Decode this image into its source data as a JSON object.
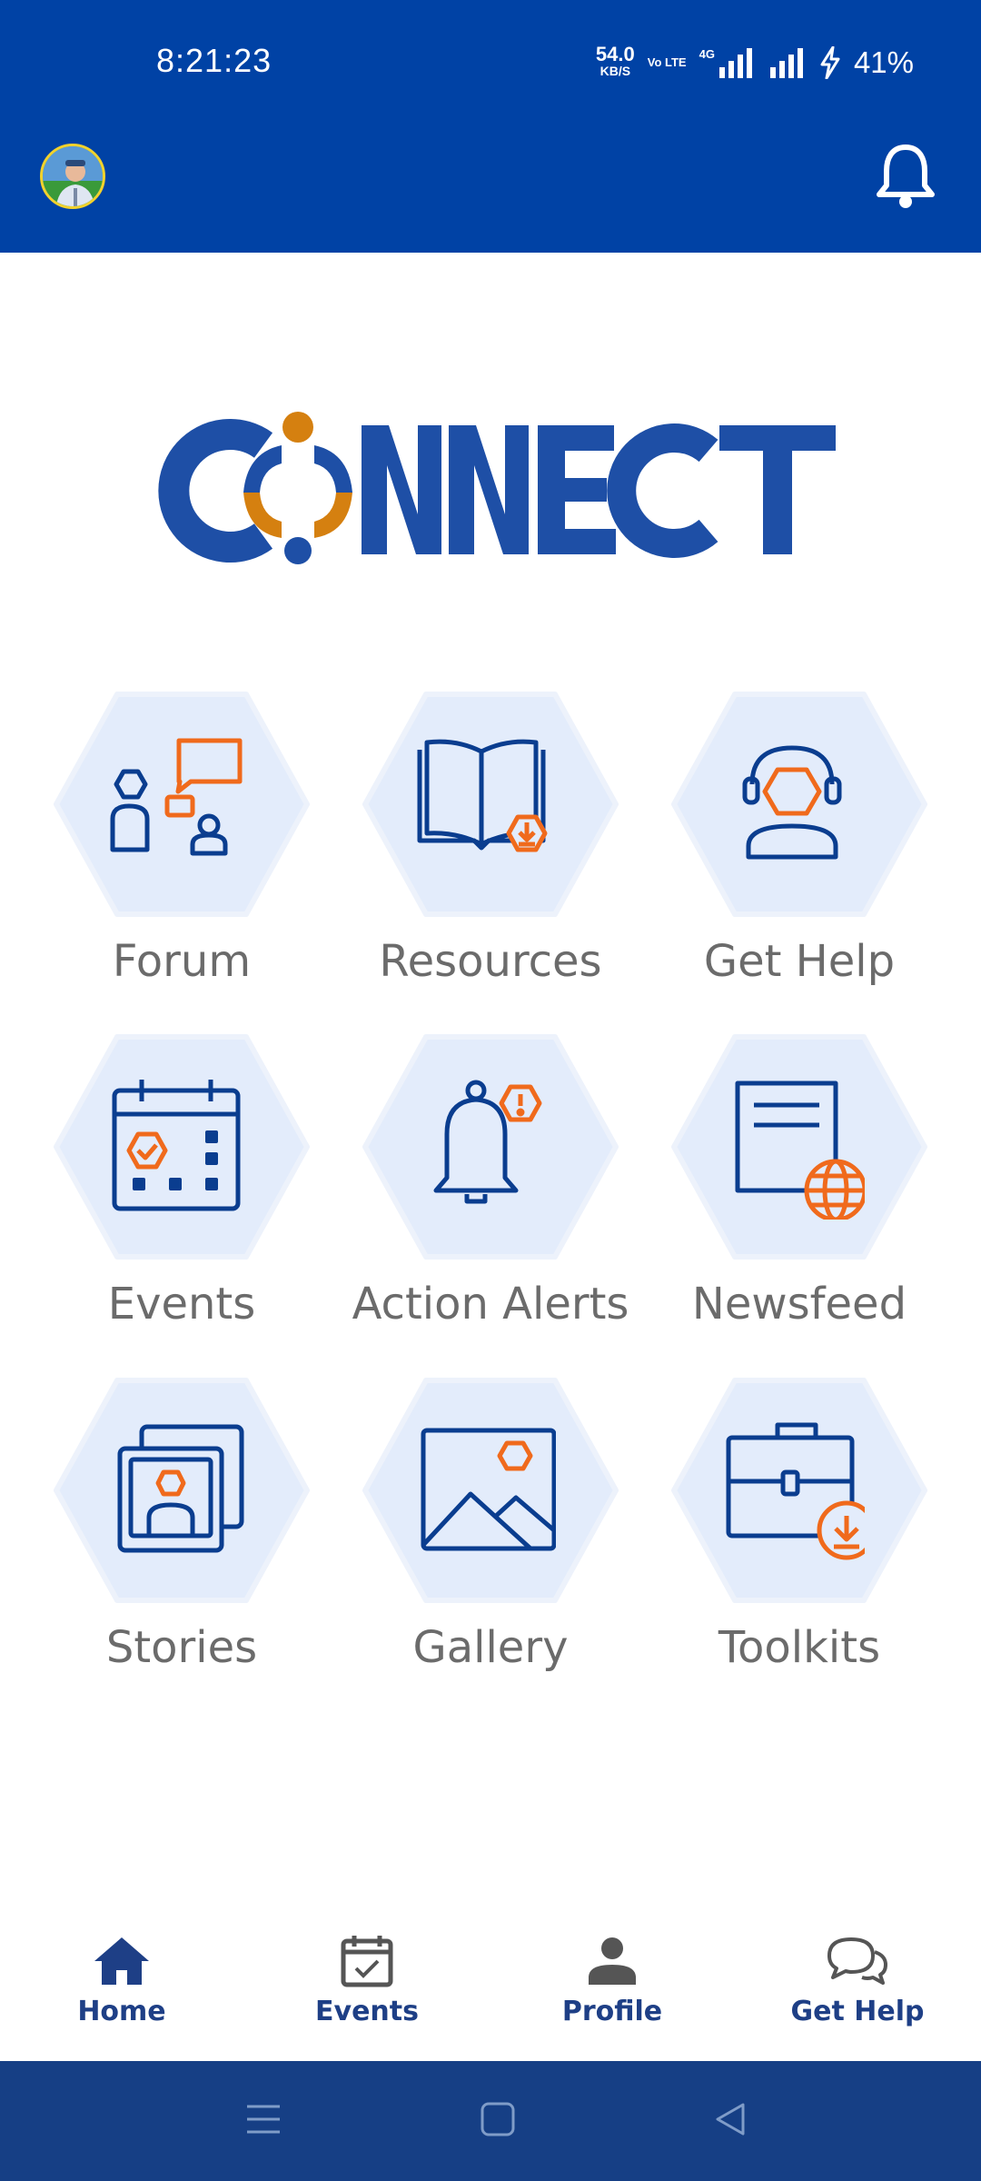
{
  "status_bar": {
    "time": "8:21:23",
    "net_speed_value": "54.0",
    "net_speed_unit": "KB/S",
    "volte": "Vo LTE",
    "network": "4G",
    "battery": "41%"
  },
  "app_bar": {
    "avatar_icon": "user-avatar",
    "notification_icon": "bell-icon"
  },
  "logo": {
    "text_left": "C",
    "text_right": "NNECT",
    "colors": {
      "blue": "#1e4fa6",
      "orange": "#d58010"
    }
  },
  "tiles": [
    {
      "label": "Forum",
      "icon": "forum-icon"
    },
    {
      "label": "Resources",
      "icon": "resources-icon"
    },
    {
      "label": "Get Help",
      "icon": "headset-icon"
    },
    {
      "label": "Events",
      "icon": "calendar-icon"
    },
    {
      "label": "Action Alerts",
      "icon": "alert-bell-icon"
    },
    {
      "label": "Newsfeed",
      "icon": "newsfeed-icon"
    },
    {
      "label": "Stories",
      "icon": "stories-icon"
    },
    {
      "label": "Gallery",
      "icon": "gallery-icon"
    },
    {
      "label": "Toolkits",
      "icon": "toolkit-icon"
    }
  ],
  "bottom_nav": [
    {
      "label": "Home",
      "icon": "home-icon",
      "active": true
    },
    {
      "label": "Events",
      "icon": "calendar-check-icon",
      "active": false
    },
    {
      "label": "Profile",
      "icon": "person-icon",
      "active": false
    },
    {
      "label": "Get Help",
      "icon": "chat-bubbles-icon",
      "active": false
    }
  ],
  "colors": {
    "header": "#0042a5",
    "tile_bg": "#e3ecfb",
    "icon_blue": "#0a3d8f",
    "icon_orange": "#f06a1c",
    "nav_active": "#1e3f86",
    "system_nav": "#163f85"
  }
}
